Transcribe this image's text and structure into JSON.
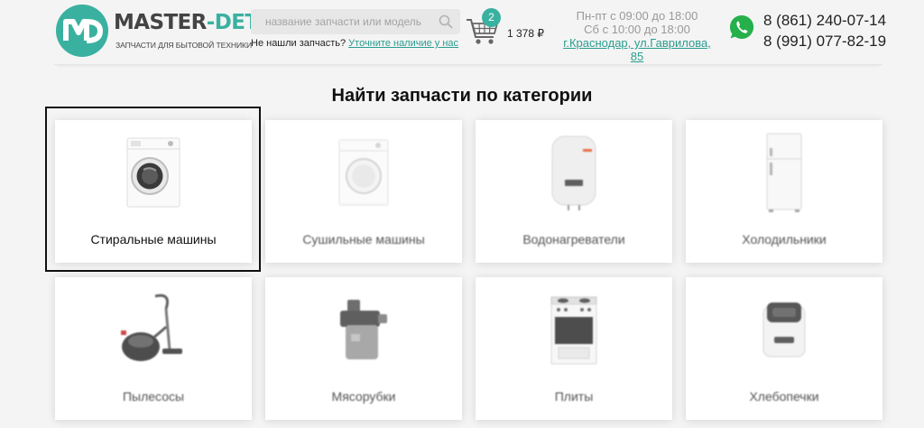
{
  "brand": {
    "name_part1": "MASTER",
    "name_part2": "-DETAL",
    "subtitle": "ЗАПЧАСТИ ДЛЯ БЫТОВОЙ ТЕХНИКИ",
    "accent_color": "#3ab1a0"
  },
  "search": {
    "placeholder": "название запчасти или модель",
    "value": "",
    "icon": "search-icon"
  },
  "not_found": {
    "text": "Не нашли запчасть?",
    "link": "Уточните наличие у нас"
  },
  "cart": {
    "count": "2",
    "total": "1 378 ₽",
    "icon": "cart-icon"
  },
  "hours": {
    "weekdays": "Пн-пт с 09:00 до 18:00",
    "saturday": "Сб с 10:00 до 18:00",
    "address": "г.Краснодар, ул.Гаврилова, 85"
  },
  "contacts": {
    "whatsapp_icon": "whatsapp-icon",
    "phone1": "8 (861) 240-07-14",
    "phone2": "8 (991) 077-82-19"
  },
  "catalog": {
    "title": "Найти запчасти по категории",
    "categories": [
      {
        "label": "Стиральные машины",
        "icon": "washing-machine"
      },
      {
        "label": "Сушильные машины",
        "icon": "dryer"
      },
      {
        "label": "Водонагреватели",
        "icon": "water-heater"
      },
      {
        "label": "Холодильники",
        "icon": "refrigerator"
      },
      {
        "label": "Пылесосы",
        "icon": "vacuum-cleaner"
      },
      {
        "label": "Мясорубки",
        "icon": "meat-grinder"
      },
      {
        "label": "Плиты",
        "icon": "stove"
      },
      {
        "label": "Хлебопечки",
        "icon": "bread-maker"
      }
    ]
  }
}
